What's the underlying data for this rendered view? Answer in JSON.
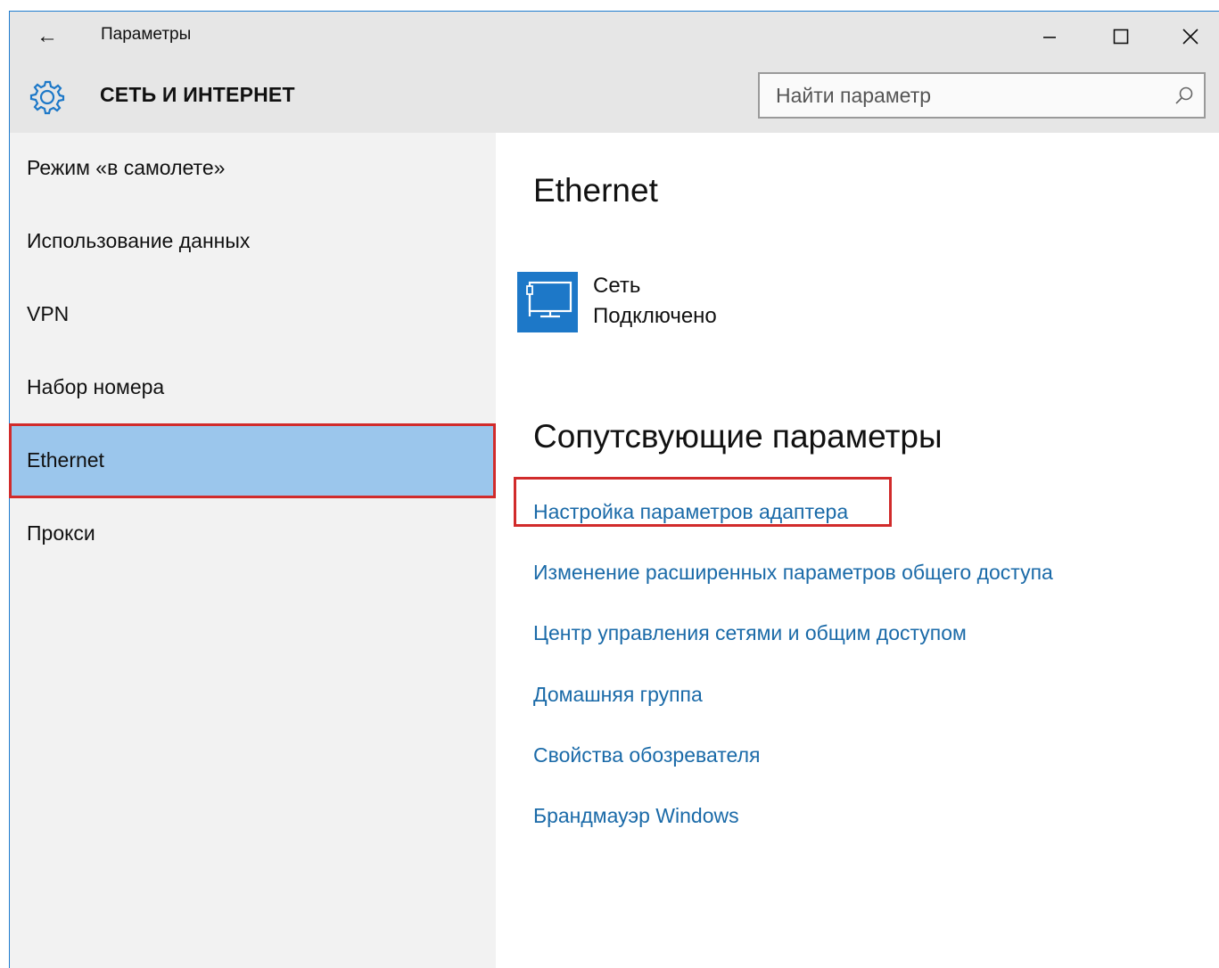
{
  "window": {
    "app_title": "Параметры",
    "back_symbol": "←",
    "controls": {
      "minimize": "—",
      "maximize": "☐",
      "close": "✕"
    }
  },
  "header": {
    "section_title": "СЕТЬ И ИНТЕРНЕТ",
    "section_icon": "gear-icon",
    "search": {
      "placeholder": "Найти параметр",
      "value": "",
      "icon": "search-icon"
    }
  },
  "sidebar": {
    "items": [
      {
        "label": "Режим «в самолете»",
        "selected": false
      },
      {
        "label": "Использование данных",
        "selected": false
      },
      {
        "label": "VPN",
        "selected": false
      },
      {
        "label": "Набор номера",
        "selected": false
      },
      {
        "label": "Ethernet",
        "selected": true
      },
      {
        "label": "Прокси",
        "selected": false
      }
    ]
  },
  "main": {
    "title": "Ethernet",
    "network": {
      "icon": "ethernet-monitor-icon",
      "name": "Сеть",
      "status": "Подключено"
    },
    "related": {
      "title": "Сопутсвующие параметры",
      "links": [
        "Настройка параметров адаптера",
        "Изменение расширенных параметров общего доступа",
        "Центр управления сетями и общим доступом",
        "Домашняя группа",
        "Свойства обозревателя",
        "Брандмауэр Windows"
      ]
    }
  },
  "colors": {
    "accent": "#1d78c8",
    "selected_bg": "#9bc6ec",
    "link": "#1a6aa8",
    "highlight": "#d12b2b",
    "sidebar_bg": "#f2f2f2",
    "header_bg": "#e6e6e6"
  }
}
